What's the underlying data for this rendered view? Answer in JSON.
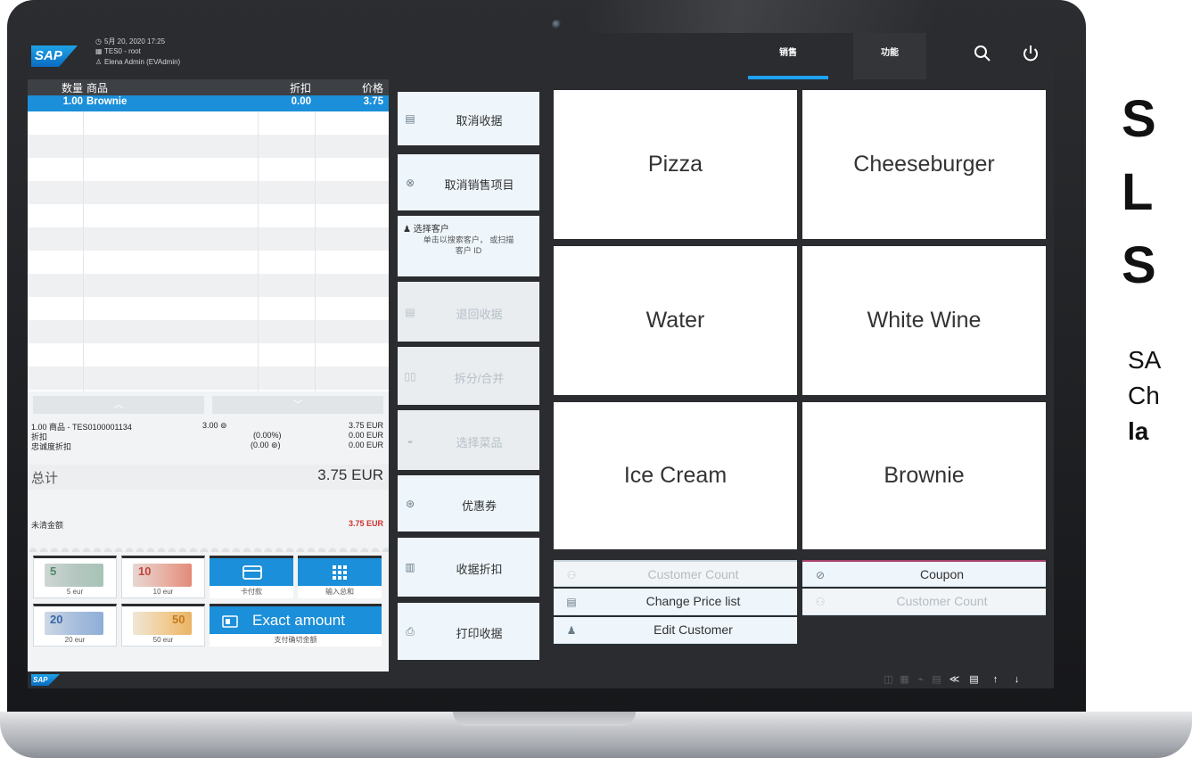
{
  "header": {
    "datetime": "5月 20, 2020 17:25",
    "store": "TES0 - root",
    "user": "Elena Admin (EVAdmin)",
    "tabs": [
      "销售",
      "功能"
    ],
    "logo": "SAP"
  },
  "receipt": {
    "columns": [
      "数量",
      "商品",
      "折扣",
      "价格"
    ],
    "items": [
      {
        "qty": "1.00",
        "name": "Brownie",
        "discount": "0.00",
        "price": "3.75"
      }
    ],
    "summary": {
      "line1_left": "1.00 商品 - TES0100001134",
      "line1_mid": "3.00 ⊚",
      "line1_right": "3.75 EUR",
      "discount_label": "折扣",
      "discount_pct": "(0.00%)",
      "discount_value": "0.00 EUR",
      "loyalty_label": "忠诚度折扣",
      "loyalty_pts": "(0.00 ⊚)",
      "loyalty_value": "0.00 EUR"
    },
    "total_label": "总计",
    "total_value": "3.75 EUR",
    "outstanding_label": "未清金额",
    "outstanding_value": "3.75 EUR"
  },
  "payment": {
    "cash": [
      {
        "denom": "5",
        "label": "5 eur"
      },
      {
        "denom": "10",
        "label": "10 eur"
      },
      {
        "denom": "20",
        "label": "20 eur"
      },
      {
        "denom": "50",
        "label": "50 eur"
      }
    ],
    "card_label": "卡付款",
    "enter_total_label": "输入总和",
    "exact_title": "Exact amount",
    "exact_label": "支付确切金额"
  },
  "actions": [
    {
      "label": "取消收据",
      "enabled": true
    },
    {
      "label": "取消销售项目",
      "enabled": true
    },
    {
      "label": "选择客户",
      "sub1": "单击以搜索客户， 或扫描",
      "sub2": "客户 ID",
      "enabled": true
    },
    {
      "label": "退回收据",
      "enabled": false
    },
    {
      "label": "拆分/合并",
      "enabled": false
    },
    {
      "label": "选择菜品",
      "enabled": false
    },
    {
      "label": "优惠券",
      "enabled": true
    },
    {
      "label": "收据折扣",
      "enabled": true
    },
    {
      "label": "打印收据",
      "enabled": true
    }
  ],
  "products": [
    "Pizza",
    "Cheeseburger",
    "Water",
    "White Wine",
    "Ice Cream",
    "Brownie"
  ],
  "functions": {
    "customer_count_1": "Customer Count",
    "coupon": "Coupon",
    "change_price_list": "Change Price list",
    "customer_count_2": "Customer Count",
    "edit_customer": "Edit Customer"
  },
  "slide": {
    "big": [
      "S",
      "L",
      "S"
    ],
    "small": [
      "SA",
      "Ch",
      "la"
    ]
  },
  "colors": {
    "accent": "#1b8fd9",
    "shell": "#2a2c2f",
    "outstanding": "#d0332e"
  }
}
